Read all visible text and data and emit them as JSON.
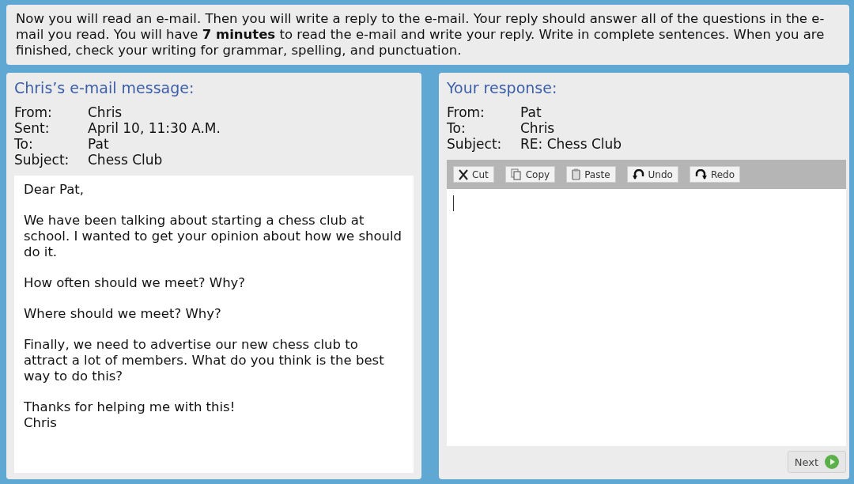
{
  "instructions": "Now you will read an e-mail. Then you will write a reply to the e-mail. Your reply should answer all of the questions in the e-mail you read. You will have **7 minutes** to read the e-mail and write your reply. Write in complete sentences. When you are finished, check your writing for grammar, spelling, and punctuation.",
  "email": {
    "title": "Chris’s e-mail message:",
    "headers": [
      {
        "label": "From:",
        "value": "Chris"
      },
      {
        "label": "Sent:",
        "value": "April 10, 11:30 A.M."
      },
      {
        "label": "To:",
        "value": "Pat"
      },
      {
        "label": "Subject:",
        "value": "Chess Club"
      }
    ],
    "body": [
      "Dear Pat,",
      "We have been talking about starting a chess club at school. I wanted to get your opinion about how we should do it.",
      "How often should we meet? Why?",
      "Where should we meet? Why?",
      "Finally, we need to advertise our new chess club to attract a lot of members. What do you think is the best way to do this?",
      "Thanks for helping me with this!\nChris"
    ]
  },
  "response": {
    "title": "Your response:",
    "headers": [
      {
        "label": "From:",
        "value": "Pat"
      },
      {
        "label": "To:",
        "value": "Chris"
      },
      {
        "label": "Subject:",
        "value": "RE: Chess Club"
      }
    ],
    "toolbar": [
      {
        "kind": "cut",
        "label": "Cut"
      },
      {
        "kind": "copy",
        "label": "Copy"
      },
      {
        "kind": "paste",
        "label": "Paste"
      },
      {
        "kind": "undo",
        "label": "Undo"
      },
      {
        "kind": "redo",
        "label": "Redo"
      }
    ]
  },
  "next_button": "Next"
}
